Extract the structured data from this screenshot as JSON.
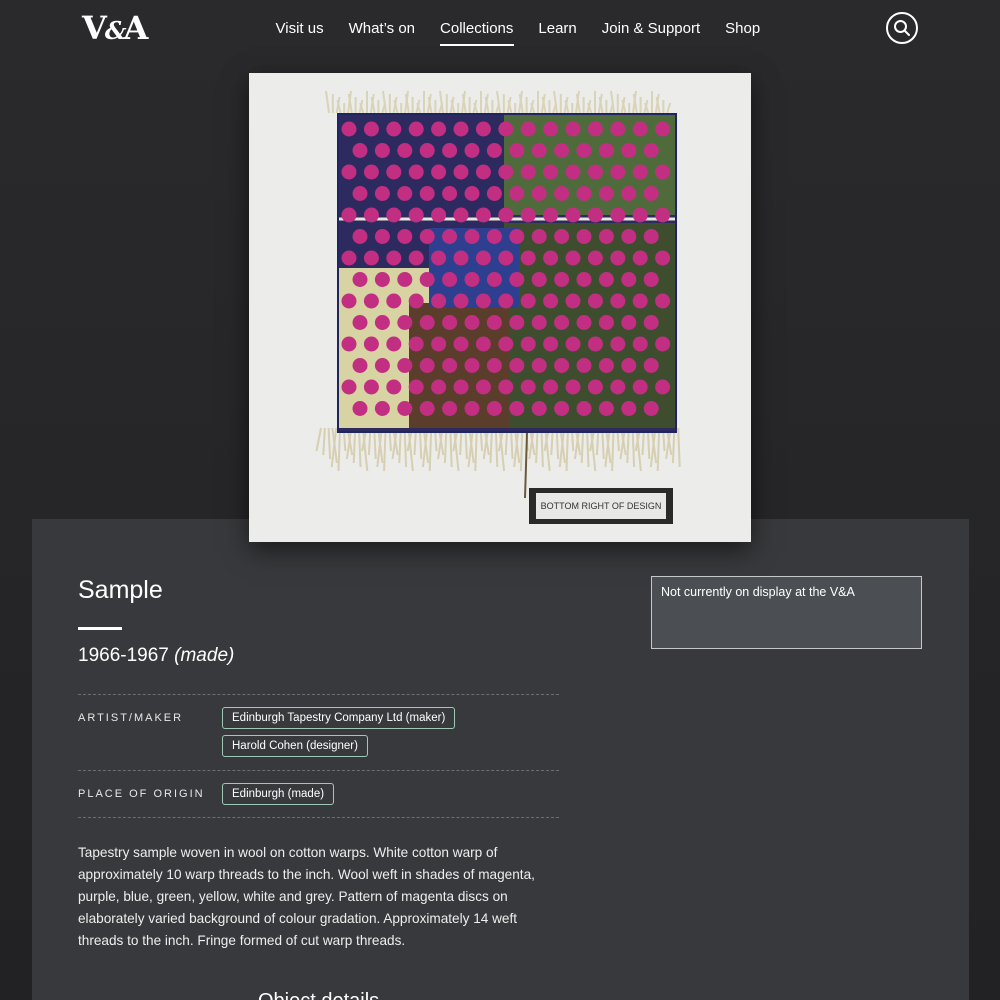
{
  "brand": {
    "logo_prefix": "V",
    "logo_amp": "&",
    "logo_suffix": "A"
  },
  "nav": {
    "items": [
      {
        "label": "Visit us"
      },
      {
        "label": "What’s on"
      },
      {
        "label": "Collections",
        "active": true
      },
      {
        "label": "Learn"
      },
      {
        "label": "Join & Support"
      },
      {
        "label": "Shop"
      }
    ]
  },
  "image": {
    "label_card_text": "BOTTOM RIGHT OF DESIGN"
  },
  "object": {
    "title": "Sample",
    "date": "1966-1967",
    "date_qualifier": "(made)",
    "artist_label": "ARTIST/MAKER",
    "artists": [
      "Edinburgh Tapestry Company Ltd (maker)",
      "Harold Cohen (designer)"
    ],
    "origin_label": "PLACE OF ORIGIN",
    "origin": "Edinburgh (made)",
    "description": "Tapestry sample woven in wool on cotton warps. White cotton warp of approximately 10 warp threads to the inch. Wool weft in shades of magenta, purple, blue, green, yellow, white and grey. Pattern of magenta discs on elaborately varied background of colour gradation. Approximately 14 weft threads to the inch. Fringe formed of cut warp threads.",
    "display_status": "Not currently on display at the V&A",
    "details_heading": "Object details"
  },
  "colors": {
    "page_bg": "#2a2a2c",
    "card_bg": "#38393c",
    "tag_border": "#9fc9b4",
    "disc_magenta": "#c22f82",
    "weave_navy": "#1f2463"
  },
  "icons": {
    "search": "search-icon"
  }
}
